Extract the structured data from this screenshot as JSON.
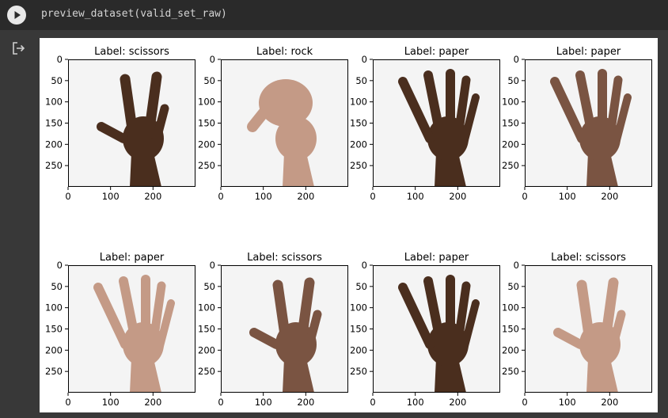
{
  "cell": {
    "code": "preview_dataset(valid_set_raw)",
    "run_icon": "play-icon",
    "output_icon": "output-redirect-icon"
  },
  "figure": {
    "colors": {
      "dark_skin": "#4a2e1e",
      "medium_skin": "#7a5442",
      "light_skin": "#c49a86"
    },
    "subplots": [
      {
        "title": "Label: scissors",
        "gesture": "scissors",
        "skin": "dark"
      },
      {
        "title": "Label: rock",
        "gesture": "rock",
        "skin": "light"
      },
      {
        "title": "Label: paper",
        "gesture": "paper",
        "skin": "dark"
      },
      {
        "title": "Label: paper",
        "gesture": "paper",
        "skin": "medium"
      },
      {
        "title": "Label: paper",
        "gesture": "paper",
        "skin": "light"
      },
      {
        "title": "Label: scissors",
        "gesture": "scissors",
        "skin": "medium"
      },
      {
        "title": "Label: paper",
        "gesture": "paper",
        "skin": "dark"
      },
      {
        "title": "Label: scissors",
        "gesture": "scissors",
        "skin": "light"
      }
    ],
    "y_ticks": [
      "0",
      "50",
      "100",
      "150",
      "200",
      "250"
    ],
    "x_ticks": [
      "0",
      "100",
      "200"
    ]
  }
}
